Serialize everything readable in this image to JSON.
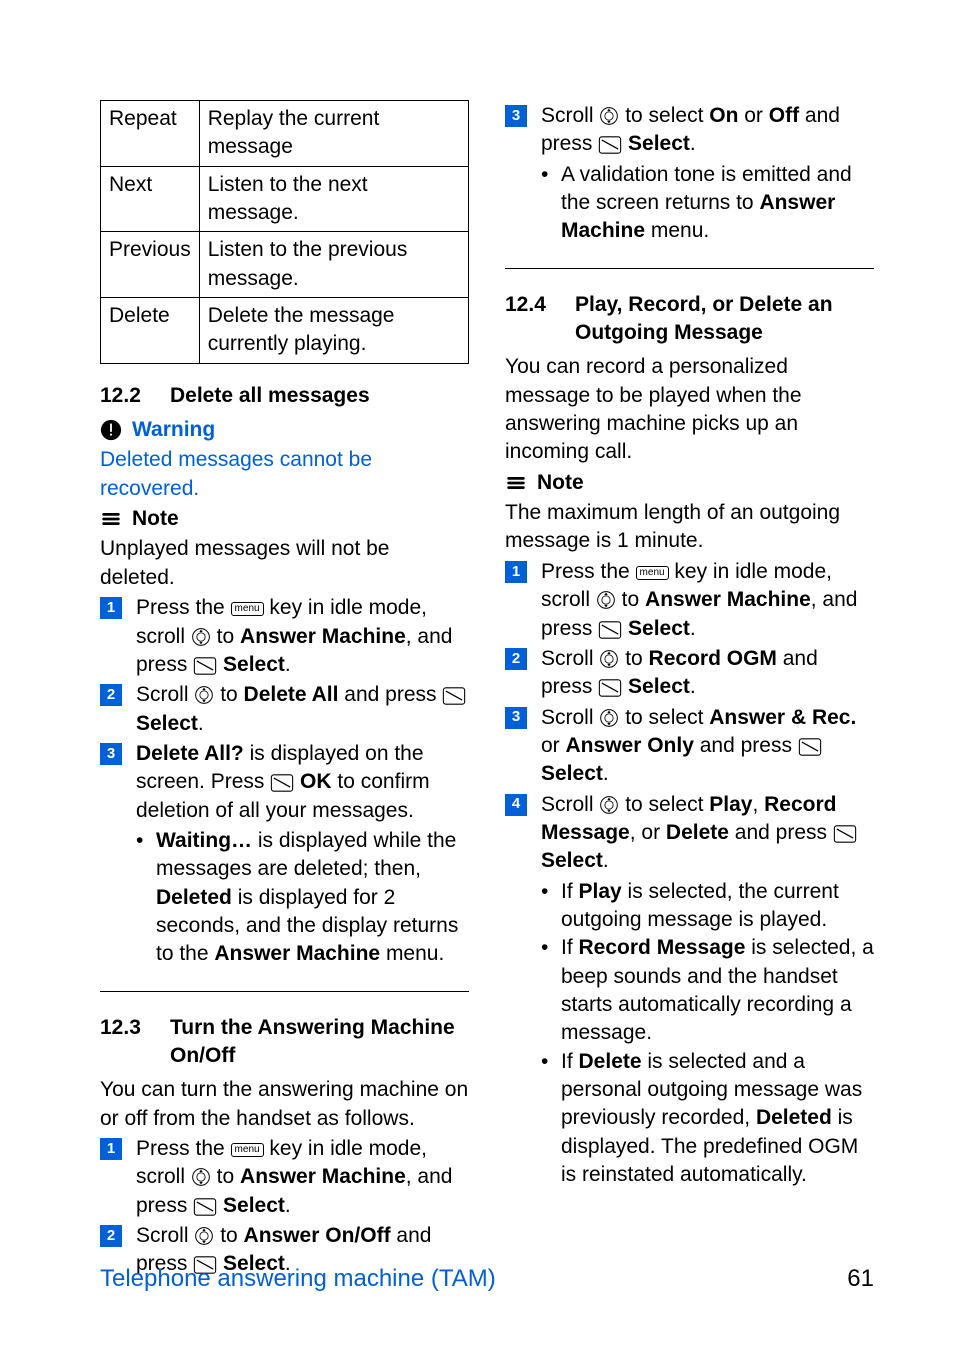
{
  "table": {
    "rows": [
      {
        "k": "Repeat",
        "v": "Replay the current message"
      },
      {
        "k": "Next",
        "v": "Listen to the next message."
      },
      {
        "k": "Previous",
        "v": "Listen to the previous message."
      },
      {
        "k": "Delete",
        "v": "Delete the message currently playing."
      }
    ]
  },
  "s122": {
    "num": "12.2",
    "title": "Delete all messages"
  },
  "warning_label": "Warning",
  "warning_body": "Deleted messages cannot be recovered.",
  "note_label": "Note",
  "note_body_1": "Unplayed messages will not be deleted.",
  "left_steps": {
    "1a": "Press the ",
    "1b": " key in idle mode, scroll ",
    "1c": " to ",
    "1d": "Answer Machine",
    "1e": ", and press ",
    "1f": " Select",
    "1g": ".",
    "2a": "Scroll ",
    "2b": " to ",
    "2c": "Delete All",
    "2d": " and press ",
    "2e": " Select",
    "2f": ".",
    "3a": "Delete All?",
    "3b": " is displayed on the screen. Press ",
    "3c": " OK",
    "3d": " to confirm deletion of all your messages.",
    "rb1a": "Waiting…",
    "rb1b": " is displayed while the messages are deleted; then, ",
    "rb1c": "Deleted",
    "rb1d": " is displayed for 2 seconds, and the display returns to the ",
    "rb1e": "Answer Machine",
    "rb1f": " menu."
  },
  "s123": {
    "num": "12.3",
    "title": "Turn the Answering Machine On/Off"
  },
  "s123_intro": "You can turn the answering machine on or off from the handset as follows.",
  "left_b": {
    "1a": "Press the ",
    "1b": " key in idle mode, scroll ",
    "1c": " to ",
    "1d": "Answer Machine",
    "1e": ", and press ",
    "1f": " Select",
    "1g": ".",
    "2a": "Scroll ",
    "2b": " to ",
    "2c": "Answer On/Off",
    "2d": " and press ",
    "2e": " Select",
    "2f": "."
  },
  "right_top": {
    "3a": "Scroll ",
    "3b": " to select ",
    "3c": "On",
    "3d": " or ",
    "3e": "Off",
    "3f": " and press ",
    "3g": " Select",
    "3h": ".",
    "rb_a": "A validation tone is emitted and the screen returns to ",
    "rb_b": "Answer Machine",
    "rb_c": " menu."
  },
  "s124": {
    "num": "12.4",
    "title": "Play, Record, or Delete an Outgoing Message"
  },
  "s124_intro": "You can record a personalized message to be played when the answering machine picks up an incoming call.",
  "note_body_2": "The maximum length of an outgoing message is 1 minute.",
  "r": {
    "1a": "Press the ",
    "1b": " key in idle mode, scroll ",
    "1c": " to ",
    "1d": "Answer Machine",
    "1e": ", and press ",
    "1f": " Select",
    "1g": ".",
    "2a": "Scroll ",
    "2b": " to ",
    "2c": "Record OGM",
    "2d": " and press ",
    "2e": " Select",
    "2f": ".",
    "3a": "Scroll ",
    "3b": " to select ",
    "3c": "Answer & Rec.",
    "3d": " or ",
    "3e": "Answer Only",
    "3f": " and press ",
    "3g": " Select",
    "3h": ".",
    "4a": "Scroll ",
    "4b": " to select ",
    "4c": "Play",
    "4d": ", ",
    "4e": "Record Message",
    "4f": ", or ",
    "4g": "Delete",
    "4h": " and press ",
    "4i": " Select",
    "4j": ".",
    "bp1a": "If ",
    "bp1b": "Play",
    "bp1c": " is selected, the current outgoing message is played.",
    "bp2a": "If ",
    "bp2b": "Record Message",
    "bp2c": " is selected, a beep sounds and the handset starts automatically recording a message.",
    "bp3a": "If ",
    "bp3b": "Delete",
    "bp3c": " is selected and a personal outgoing message was previously recorded, ",
    "bp3d": "Deleted",
    "bp3e": " is displayed. The predefined OGM is reinstated automatically."
  },
  "footer": {
    "section": "Telephone answering machine (TAM)",
    "page": "61"
  },
  "keys": {
    "menu": "menu"
  }
}
